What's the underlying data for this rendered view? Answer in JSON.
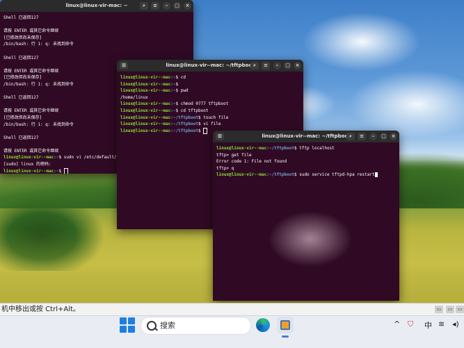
{
  "windows": [
    {
      "title": "linux@linux-vir-mac: ~",
      "lines": [
        {
          "text": "Shell 已返回127"
        },
        {
          "text": ""
        },
        {
          "text": "请按 ENTER 或其它命令继续"
        },
        {
          "text": "[已修改但尚未保存]"
        },
        {
          "text": "/bin/bash: 行 1: q: 未找到命令"
        },
        {
          "text": ""
        },
        {
          "text": "Shell 已返回127"
        },
        {
          "text": ""
        },
        {
          "text": "请按 ENTER 或其它命令继续"
        },
        {
          "text": "[已修改但尚未保存]"
        },
        {
          "text": "/bin/bash: 行 1: q: 未找到命令"
        },
        {
          "text": ""
        },
        {
          "text": "Shell 已返回127"
        },
        {
          "text": ""
        },
        {
          "text": "请按 ENTER 或其它命令继续"
        },
        {
          "text": "[已修改但尚未保存]"
        },
        {
          "text": "/bin/bash: 行 1: q: 未找到命令"
        },
        {
          "text": ""
        },
        {
          "text": "Shell 已返回127"
        },
        {
          "text": ""
        },
        {
          "text": "请按 ENTER 或其它命令继续"
        },
        {
          "prompt_user": "linux@linux-vir--mac",
          "prompt_path": ":~",
          "cmd": "$ sudo vi /etc/default/tft"
        },
        {
          "text": "[sudo] linux 的密码:"
        },
        {
          "prompt_user": "linux@linux-vir--mac",
          "prompt_path": ":~",
          "cmd": "$ "
        }
      ]
    },
    {
      "title": "linux@linux-vir--mac: ~/tftpboot",
      "lines": [
        {
          "prompt_user": "linux@linux-vir--mac",
          "prompt_path": ":~",
          "cmd": "$ cd"
        },
        {
          "prompt_user": "linux@linux-vir--mac",
          "prompt_path": ":~",
          "cmd": "$"
        },
        {
          "prompt_user": "linux@linux-vir--mac",
          "prompt_path": ":~",
          "cmd": "$ pwd"
        },
        {
          "text": "/home/linux"
        },
        {
          "prompt_user": "linux@linux-vir--mac",
          "prompt_path": ":~",
          "cmd": "$ chmod 0777 tftpboot"
        },
        {
          "prompt_user": "linux@linux-vir--mac",
          "prompt_path": ":~",
          "cmd": "$ cd tftpboot"
        },
        {
          "prompt_user": "linux@linux-vir--mac",
          "prompt_path": ":~/tftpboot",
          "cmd": "$ touch file"
        },
        {
          "prompt_user": "linux@linux-vir--mac",
          "prompt_path": ":~/tftpboot",
          "cmd": "$ vi file"
        },
        {
          "prompt_user": "linux@linux-vir--mac",
          "prompt_path": ":~/tftpboot",
          "cmd": "$ "
        }
      ]
    },
    {
      "title": "linux@linux-vir--mac: ~/tftpboot",
      "lines": [
        {
          "prompt_user": "linux@linux-vir--mac",
          "prompt_path": ":~/tftpboot",
          "cmd": "$ tftp localhost"
        },
        {
          "text": "tftp> get file"
        },
        {
          "text": "Error code 1: File not found"
        },
        {
          "text": "tftp> q"
        },
        {
          "prompt_user": "linux@linux-vir--mac",
          "prompt_path": ":~/tftpboot",
          "cmd": "$ sudo service tftpd-hpa restart"
        }
      ]
    }
  ],
  "notification": {
    "text": "机中移出或按 Ctrl+Alt。"
  },
  "taskbar": {
    "search_placeholder": "搜索",
    "tray_ime": "中",
    "tray_caret": "^"
  },
  "icons": {
    "new_tab": "new-tab-icon",
    "search": "search-icon",
    "menu": "hamburger-menu-icon",
    "minimize": "minimize-icon",
    "maximize": "maximize-icon",
    "close": "close-icon"
  }
}
